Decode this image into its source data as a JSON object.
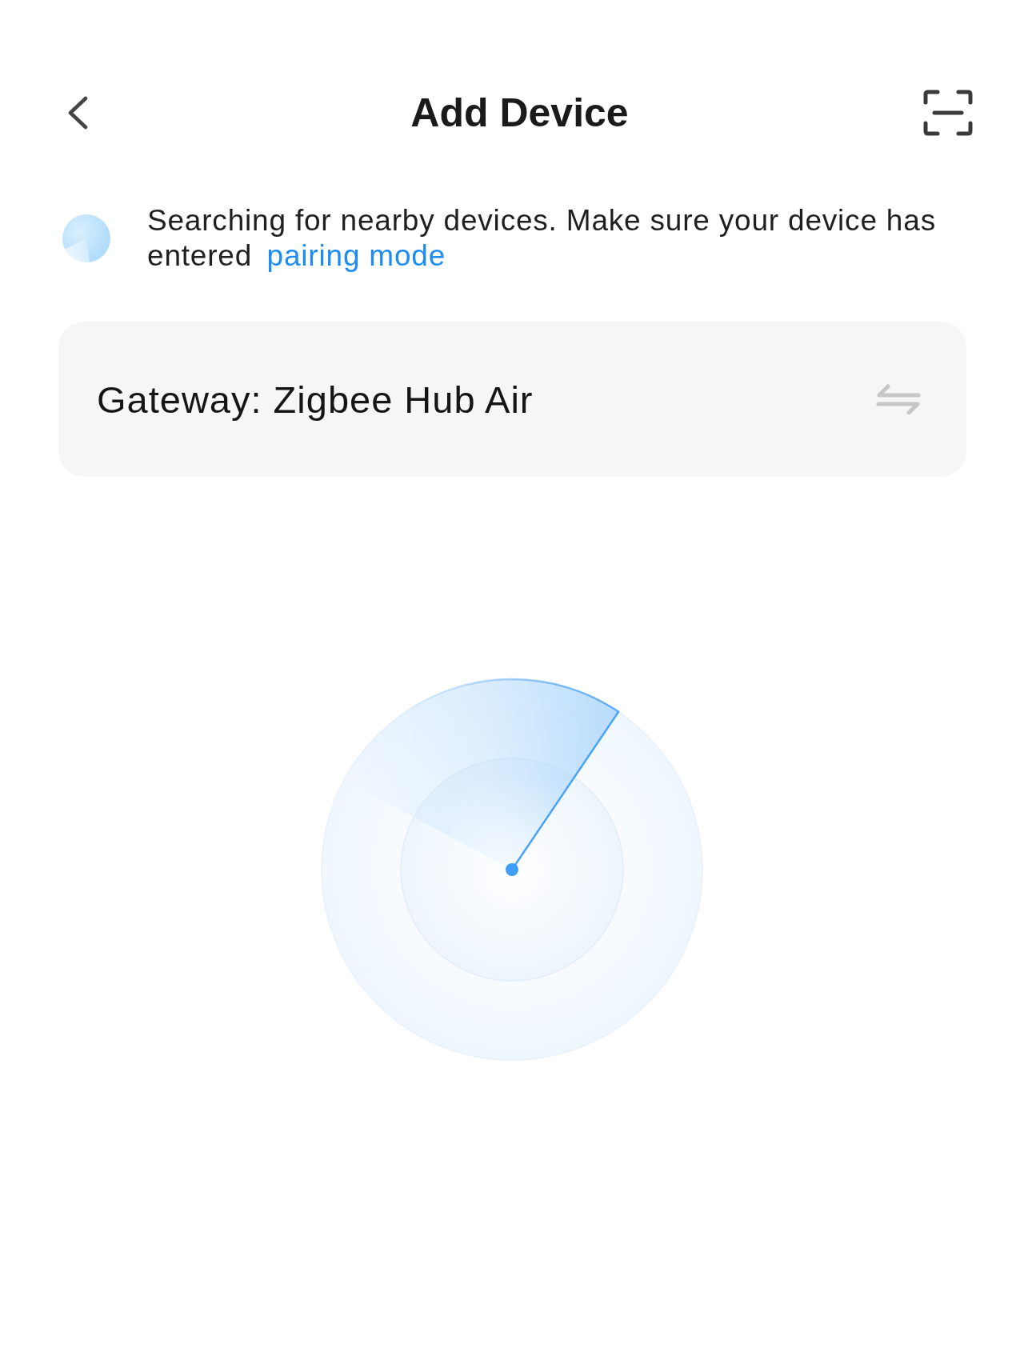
{
  "header": {
    "title": "Add Device"
  },
  "search_notice": {
    "text": "Searching for nearby devices. Make sure your device has entered",
    "link": "pairing mode"
  },
  "gateway": {
    "label": "Gateway: Zigbee Hub Air"
  }
}
